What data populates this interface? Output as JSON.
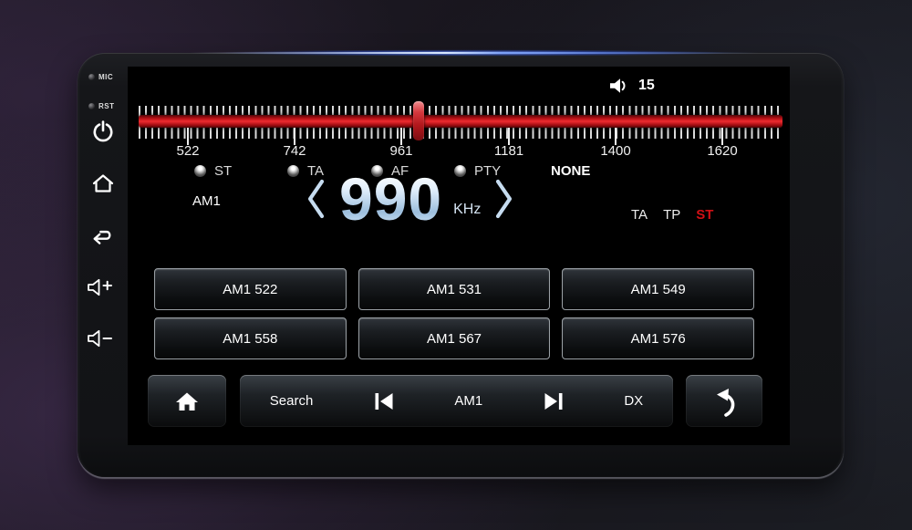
{
  "bezel": {
    "mic_label": "MIC",
    "rst_label": "RST"
  },
  "status": {
    "volume": "15"
  },
  "tuner": {
    "scale_labels": [
      "522",
      "742",
      "961",
      "1181",
      "1400",
      "1620"
    ],
    "band": "AM1",
    "frequency": "990",
    "unit": "KHz",
    "indicators": [
      "ST",
      "TA",
      "AF",
      "PTY"
    ],
    "pty": "NONE",
    "flags": [
      {
        "label": "TA",
        "active": false
      },
      {
        "label": "TP",
        "active": false
      },
      {
        "label": "ST",
        "active": true
      }
    ]
  },
  "presets": [
    "AM1 522",
    "AM1 531",
    "AM1 549",
    "AM1 558",
    "AM1 567",
    "AM1 576"
  ],
  "toolbar": {
    "search": "Search",
    "band": "AM1",
    "dx": "DX"
  },
  "colors": {
    "accent_red": "#c8121a",
    "active_flag": "#d01015"
  }
}
